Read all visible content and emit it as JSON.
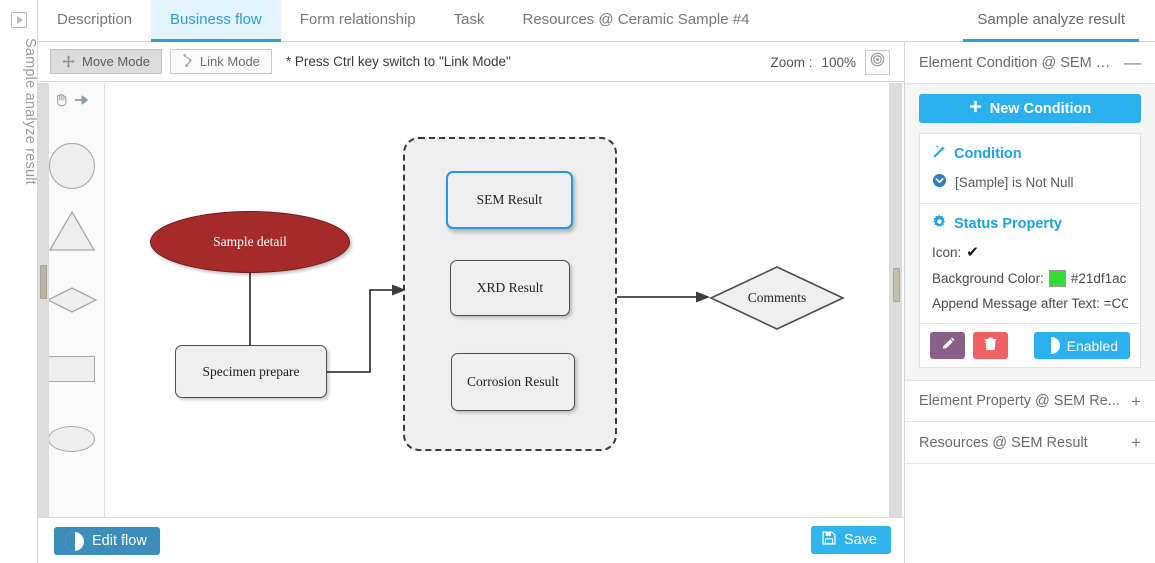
{
  "rail": {
    "icon": "expand-panel-icon",
    "label": "Sample analyze result"
  },
  "tabs": [
    {
      "label": "Description",
      "active": false
    },
    {
      "label": "Business flow",
      "active": true
    },
    {
      "label": "Form relationship",
      "active": false
    },
    {
      "label": "Task",
      "active": false
    },
    {
      "label": "Resources @ Ceramic Sample #4",
      "active": false
    }
  ],
  "tab_right": {
    "label": "Sample analyze result"
  },
  "toolbar": {
    "move_mode": "Move Mode",
    "link_mode": "Link Mode",
    "hint": "* Press Ctrl key switch to \"Link Mode\"",
    "zoom_label": "Zoom :",
    "zoom_value": "100%",
    "zoom_reset_icon": "target-icon"
  },
  "palette": {
    "items": [
      {
        "name": "hand-tool-icon",
        "label": "hand"
      },
      {
        "name": "arrow-tool-icon",
        "label": "arrow"
      },
      {
        "name": "shape-circle",
        "label": "circle"
      },
      {
        "name": "shape-triangle",
        "label": "triangle"
      },
      {
        "name": "shape-diamond",
        "label": "diamond"
      },
      {
        "name": "shape-rectangle",
        "label": "rectangle"
      },
      {
        "name": "shape-ellipse",
        "label": "ellipse"
      }
    ]
  },
  "diagram": {
    "nodes": [
      {
        "id": "sample-detail",
        "label": "Sample detail",
        "shape": "ellipse",
        "fill": "#a52a2a"
      },
      {
        "id": "specimen-prepare",
        "label": "Specimen prepare",
        "shape": "rect"
      },
      {
        "id": "sem-result",
        "label": "SEM Result",
        "shape": "rect",
        "selected": true
      },
      {
        "id": "xrd-result",
        "label": "XRD Result",
        "shape": "rect"
      },
      {
        "id": "corrosion-result",
        "label": "Corrosion Result",
        "shape": "rect"
      },
      {
        "id": "comments",
        "label": "Comments",
        "shape": "diamond"
      }
    ],
    "group": {
      "id": "result-group",
      "label": ""
    },
    "edges": [
      {
        "from": "sample-detail",
        "to": "specimen-prepare"
      },
      {
        "from": "specimen-prepare",
        "to": "result-group"
      },
      {
        "from": "result-group",
        "to": "comments"
      }
    ]
  },
  "bottom": {
    "edit_flow": "Edit flow",
    "save": "Save",
    "save_icon": "floppy-disk-icon"
  },
  "right_panel": {
    "sections": [
      {
        "title": "Element Condition @ SEM R...",
        "sign": "—",
        "expanded": true
      },
      {
        "title": "Element Property @ SEM Re...",
        "sign": "+",
        "expanded": false
      },
      {
        "title": "Resources @ SEM Result",
        "sign": "+",
        "expanded": false
      }
    ],
    "new_condition": "New Condition",
    "new_condition_icon": "plus-icon",
    "condition": {
      "heading": "Condition",
      "heading_icon": "magic-wand-icon",
      "row_icon": "chevron-down-circle-icon",
      "expression": "[Sample] is Not Null"
    },
    "status_property": {
      "heading": "Status Property",
      "heading_icon": "gear-icon",
      "icon_label": "Icon:",
      "icon_glyph": "✔",
      "bg_label": "Background Color:",
      "bg_value": "#21df1ac",
      "bg_swatch": "#33dd33",
      "append_label": "Append Message after Text: =CO"
    },
    "actions": {
      "edit_icon": "pencil-icon",
      "delete_icon": "trash-icon",
      "enabled_label": "Enabled"
    }
  }
}
